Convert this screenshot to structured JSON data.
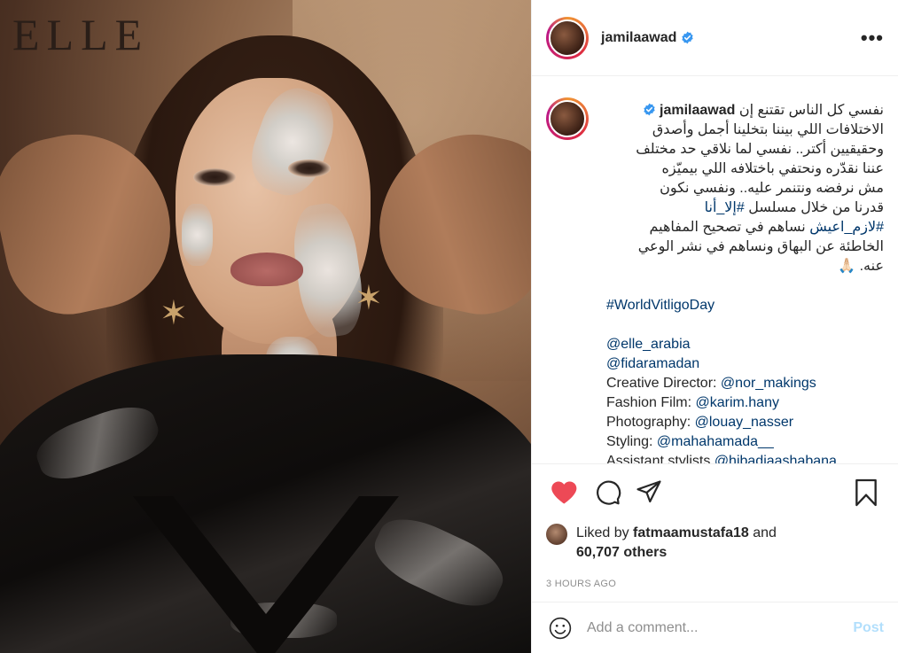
{
  "photo": {
    "logo": "ELLE",
    "logo_sub": "ELLE"
  },
  "header": {
    "username": "jamilaawad",
    "more_icon": "ellipsis-icon"
  },
  "caption": {
    "username": "jamilaawad",
    "arabic_lines": [
      "نفسي كل الناس تقتنع إن",
      "الاختلافات اللي بيننا بتخلينا أجمل وأصدق",
      "وحقيقيين أكتر.. نفسي لما نلاقي حد مختلف",
      "عننا نقدّره ونحتفي باختلافه اللي بيميّزه",
      "مش نرفضه ونتنمر عليه.. ونفسي نكون",
      "قدرنا من خلال مسلسل",
      "نساهم في تصحيح المفاهيم",
      "الخاطئة عن البهاق ونساهم في نشر الوعي",
      "عنه. 🙏🏻"
    ],
    "hashtag_series": "#إلا_أنا",
    "hashtag_lazem": "#لازم_اعيش",
    "hashtag_world": "#WorldVitligoDay",
    "mention_elle": "@elle_arabia",
    "mention_fida": "@fidaramadan",
    "credits": [
      {
        "label": "Creative Director: ",
        "handle": "@nor_makings"
      },
      {
        "label": "Fashion Film: ",
        "handle": "@karim.hany"
      },
      {
        "label": "Photography: ",
        "handle": "@louay_nasser"
      },
      {
        "label": "Styling: ",
        "handle": "@mahahamada__"
      },
      {
        "label": "Assistant stylists ",
        "handle": "@hibadiaashabana"
      }
    ]
  },
  "likes": {
    "prefix": "Liked by ",
    "user": "fatmaamustafa18",
    "and": " and",
    "count": "60,707 others"
  },
  "timestamp": "3 HOURS AGO",
  "comment": {
    "placeholder": "Add a comment...",
    "post_label": "Post"
  },
  "colors": {
    "heart": "#ed4956",
    "link": "#00376b",
    "verified": "#3897f0",
    "post_disabled": "#b2dffc"
  }
}
